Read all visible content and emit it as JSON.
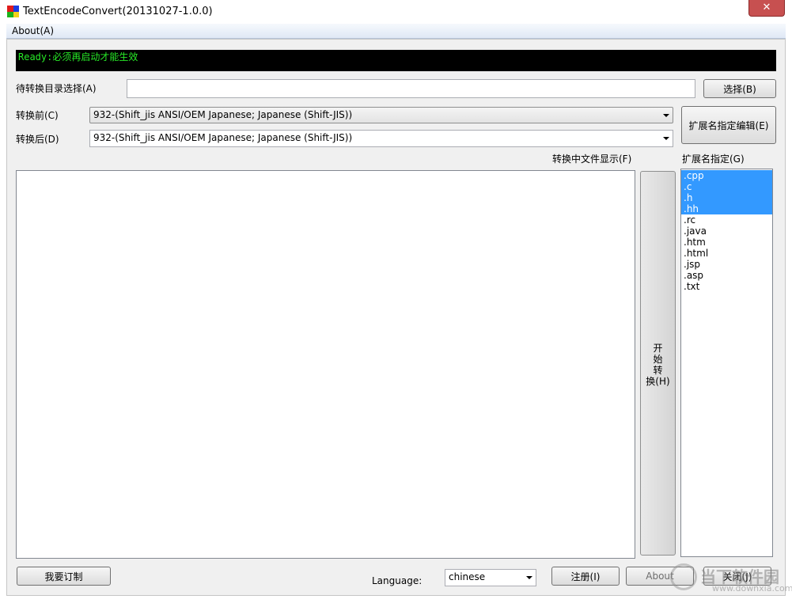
{
  "window": {
    "title": "TextEncodeConvert(20131027-1.0.0)",
    "close_label": "✕"
  },
  "menu": {
    "items": [
      "About(A)"
    ]
  },
  "status": {
    "text": "Ready:必须再启动才能生效"
  },
  "dir": {
    "label": "待转换目录选择(A)",
    "value": "",
    "browse_label": "选择(B)"
  },
  "encoding": {
    "before_label": "转换前(C)",
    "before_value": "932-(Shift_jis ANSI/OEM Japanese; Japanese (Shift-JIS))",
    "after_label": "转换后(D)",
    "after_value": "932-(Shift_jis ANSI/OEM Japanese; Japanese (Shift-JIS))",
    "edit_ext_label": "扩展名指定编辑(E)"
  },
  "display": {
    "label": "转换中文件显示(F)"
  },
  "start": {
    "lines": [
      "开",
      "始",
      "转",
      "换(H)"
    ]
  },
  "extensions": {
    "label": "扩展名指定(G)",
    "items": [
      {
        "text": ".cpp",
        "selected": true
      },
      {
        "text": ".c",
        "selected": true
      },
      {
        "text": ".h",
        "selected": true
      },
      {
        "text": ".hh",
        "selected": true
      },
      {
        "text": ".rc",
        "selected": false
      },
      {
        "text": ".java",
        "selected": false
      },
      {
        "text": ".htm",
        "selected": false
      },
      {
        "text": ".html",
        "selected": false
      },
      {
        "text": ".jsp",
        "selected": false
      },
      {
        "text": ".asp",
        "selected": false
      },
      {
        "text": ".txt",
        "selected": false
      }
    ]
  },
  "footer": {
    "order_label": "我要订制",
    "language_label": "Language:",
    "language_value": "chinese",
    "register_label": "注册(I)",
    "about_label": "About",
    "close_label": "关闭(J)"
  },
  "watermark": {
    "text": "当下软件园",
    "sub": "www.downxia.com"
  },
  "colors": {
    "status_bg": "#000000",
    "status_fg": "#27e827",
    "selection": "#3399ff",
    "close_button": "#c75050"
  }
}
